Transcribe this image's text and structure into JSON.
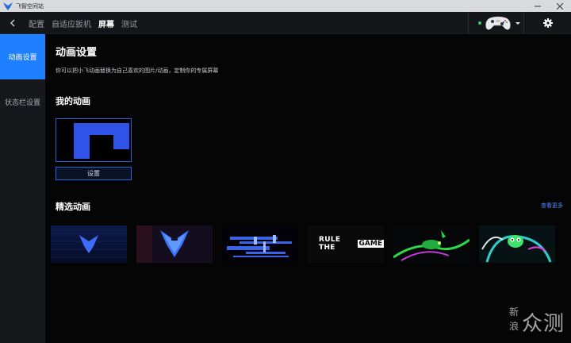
{
  "window": {
    "title": "飞智空间站"
  },
  "topnav": {
    "tabs": [
      {
        "label": "配置",
        "active": false
      },
      {
        "label": "自适应扳机",
        "active": false
      },
      {
        "label": "屏幕",
        "active": true
      },
      {
        "label": "测试",
        "active": false
      }
    ],
    "device_status_color": "#2ad36a"
  },
  "sidebar": {
    "items": [
      {
        "label": "动画设置",
        "active": true
      },
      {
        "label": "状态栏设置",
        "active": false
      }
    ],
    "accent": "#1e7fff"
  },
  "main": {
    "title": "动画设置",
    "description": "你可以把小飞动画替换为自己喜欢的图片/动画，定制你的专属屏幕",
    "my_animation": {
      "heading": "我的动画",
      "setup_label": "设置"
    },
    "featured": {
      "heading": "精选动画",
      "see_more": "查看更多",
      "thumbnails": [
        {
          "name": "feizhi-logo-blue"
        },
        {
          "name": "feizhi-logo-glitch"
        },
        {
          "name": "feizhi-text-glitch"
        },
        {
          "name": "rule-the-game",
          "text_a": "RULE THE",
          "text_b": "GAME"
        },
        {
          "name": "neon-lizard-green"
        },
        {
          "name": "neon-creature-teal"
        }
      ]
    }
  },
  "watermark": {
    "line1": "新",
    "line2": "浪",
    "big": "众测"
  }
}
